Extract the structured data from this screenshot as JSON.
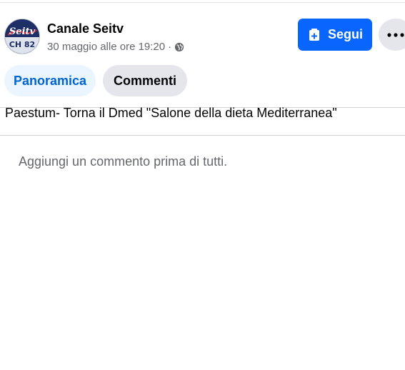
{
  "post": {
    "page_name": "Canale Seitv",
    "timestamp": "30 maggio alle ore 19:20",
    "separator": "·",
    "audience_icon": "globe-icon",
    "text": "Paestum- Torna il Dmed \"Salone della dieta Mediterranea\""
  },
  "avatar": {
    "logo_top": "Seitv",
    "logo_bottom": "CH 82"
  },
  "actions": {
    "follow_label": "Segui",
    "follow_icon": "follow-page-icon",
    "more_icon": "more-options-icon"
  },
  "tabs": [
    {
      "label": "Panoramica",
      "active": true
    },
    {
      "label": "Commenti",
      "active": false
    }
  ],
  "comments": {
    "empty_text": "Aggiungi un commento prima di tutti."
  },
  "colors": {
    "accent": "#0866ff",
    "active_tab_bg": "#ebf5ff",
    "active_tab_text": "#0064d1",
    "secondary_text": "#65676b"
  }
}
